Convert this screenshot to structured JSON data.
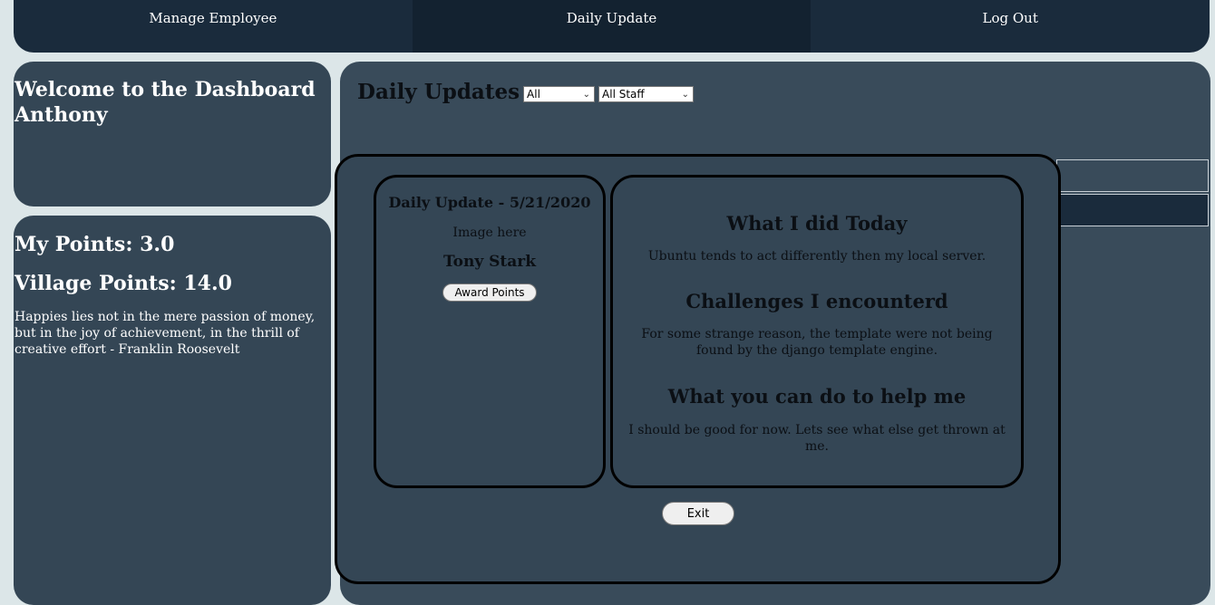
{
  "nav": {
    "items": [
      {
        "label": "Manage Employee"
      },
      {
        "label": "Daily Update"
      },
      {
        "label": "Log Out"
      }
    ]
  },
  "welcome": {
    "line1": "Welcome to the Dashboard",
    "line2": "Anthony"
  },
  "points": {
    "my_points": "My Points: 3.0",
    "village_points": "Village Points: 14.0",
    "quote": "Happies lies not in the mere passion of money, but in the joy of achievement, in the thrill of creative effort - Franklin Roosevelt"
  },
  "main": {
    "title": "Daily Updates",
    "filter_period": "All",
    "filter_staff": "All Staff"
  },
  "modal": {
    "header": "Daily Update - 5/21/2020",
    "image_placeholder": "Image here",
    "employee_name": "Tony Stark",
    "award_button": "Award Points",
    "sections": [
      {
        "heading": "What I did Today",
        "text": "Ubuntu tends to act differently then my local server."
      },
      {
        "heading": "Challenges I encounterd",
        "text": "For some strange reason, the template were not being found by the django template engine."
      },
      {
        "heading": "What you can do to help me",
        "text": "I should be good for now. Lets see what else get thrown at me."
      }
    ],
    "exit_button": "Exit"
  },
  "colors": {
    "nav_bg": "#1a2b3c",
    "panel_bg": "#344655",
    "page_bg": "#dce6e8"
  }
}
